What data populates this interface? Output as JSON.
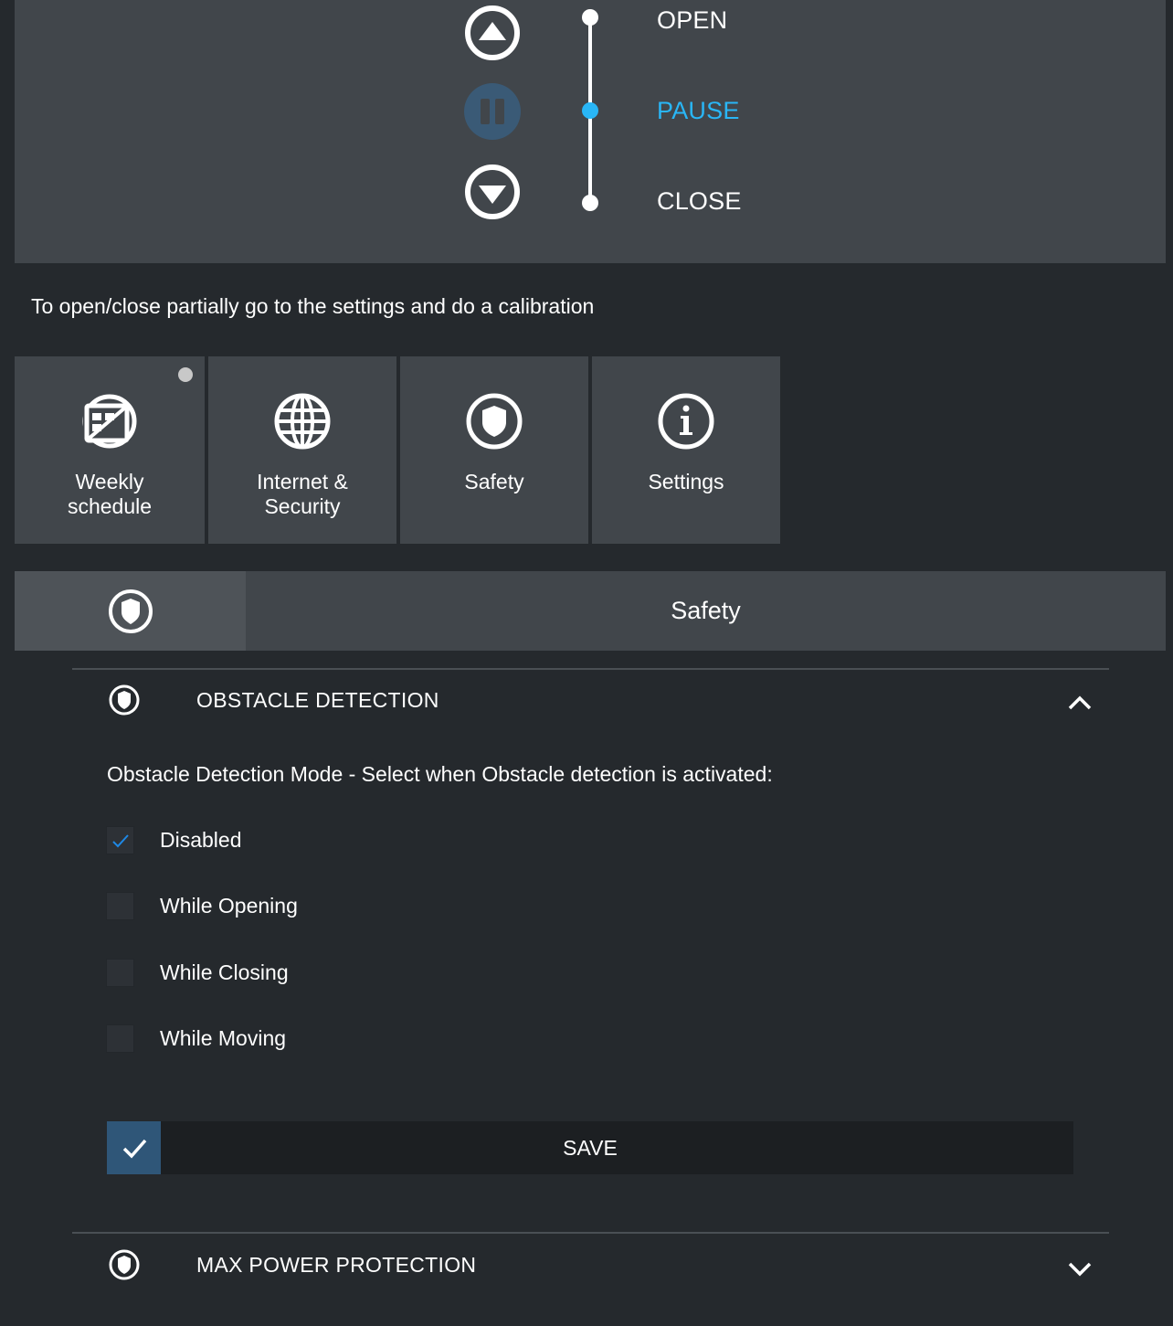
{
  "control": {
    "open_label": "OPEN",
    "pause_label": "PAUSE",
    "close_label": "CLOSE",
    "active_state": "PAUSE",
    "accent_color": "#29b6f6"
  },
  "calibration_note": "To open/close partially go to the settings and do a calibration",
  "tiles": [
    {
      "label": "Weekly\nschedule",
      "icon": "calendar-icon"
    },
    {
      "label": "Internet &\nSecurity",
      "icon": "globe-icon"
    },
    {
      "label": "Safety",
      "icon": "shield-icon"
    },
    {
      "label": "Settings",
      "icon": "info-icon"
    }
  ],
  "section": {
    "title": "Safety",
    "icon": "shield-icon"
  },
  "obstacle": {
    "title": "OBSTACLE DETECTION",
    "expanded": true,
    "description": "Obstacle Detection Mode - Select when Obstacle detection is activated:",
    "options": [
      {
        "label": "Disabled",
        "checked": true
      },
      {
        "label": "While Opening",
        "checked": false
      },
      {
        "label": "While Closing",
        "checked": false
      },
      {
        "label": "While Moving",
        "checked": false
      }
    ],
    "save_label": "SAVE"
  },
  "max_power": {
    "title": "MAX POWER PROTECTION",
    "expanded": false
  }
}
